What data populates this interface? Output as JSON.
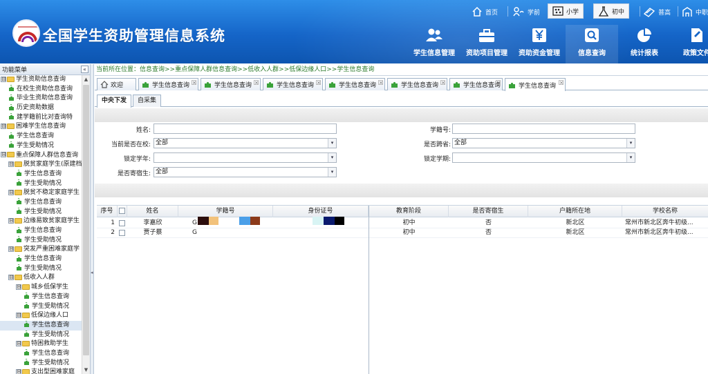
{
  "header": {
    "title": "全国学生资助管理信息系统",
    "top_links": [
      {
        "label": "首页",
        "icon": "home-icon"
      },
      {
        "label": "学前",
        "icon": "child-icon"
      },
      {
        "label": "小学",
        "icon": "abacus-icon"
      },
      {
        "label": "初中",
        "icon": "flask-icon"
      },
      {
        "label": "普高",
        "icon": "book-icon"
      },
      {
        "label": "中职",
        "icon": "building-icon"
      }
    ],
    "nav": [
      {
        "label": "学生信息管理",
        "icon": "users-icon"
      },
      {
        "label": "资助项目管理",
        "icon": "briefcase-icon"
      },
      {
        "label": "资助资金管理",
        "icon": "yuan-icon"
      },
      {
        "label": "信息查询",
        "icon": "search-icon"
      },
      {
        "label": "统计报表",
        "icon": "pie-chart-icon"
      },
      {
        "label": "政策文件",
        "icon": "document-icon"
      }
    ],
    "active_nav": "信息查询"
  },
  "sidebar": {
    "title": "功能菜单",
    "collapse_glyph": "«",
    "tree": [
      {
        "label": "学生资助信息查询",
        "level": 0,
        "type": "folder",
        "expander": "⊟"
      },
      {
        "label": "在校生资助信息查询",
        "level": 1,
        "type": "leaf"
      },
      {
        "label": "毕业生资助信息查询",
        "level": 1,
        "type": "leaf"
      },
      {
        "label": "历史资助数据",
        "level": 1,
        "type": "leaf"
      },
      {
        "label": "建学籍前比对查询特",
        "level": 1,
        "type": "leaf"
      },
      {
        "label": "困难学生信息查询",
        "level": 0,
        "type": "folder",
        "expander": "⊟"
      },
      {
        "label": "学生信息查询",
        "level": 1,
        "type": "leaf"
      },
      {
        "label": "学生受助情况",
        "level": 1,
        "type": "leaf"
      },
      {
        "label": "重点保障人群信息查询",
        "level": 0,
        "type": "folder",
        "expander": "⊟"
      },
      {
        "label": "脱贫家庭学生(原建档",
        "level": 1,
        "type": "folder",
        "expander": "⊟"
      },
      {
        "label": "学生信息查询",
        "level": 2,
        "type": "leaf"
      },
      {
        "label": "学生受助情况",
        "level": 2,
        "type": "leaf"
      },
      {
        "label": "脱贫不稳定家庭学生",
        "level": 1,
        "type": "folder",
        "expander": "⊟"
      },
      {
        "label": "学生信息查询",
        "level": 2,
        "type": "leaf"
      },
      {
        "label": "学生受助情况",
        "level": 2,
        "type": "leaf"
      },
      {
        "label": "边缘易致贫家庭学生",
        "level": 1,
        "type": "folder",
        "expander": "⊟"
      },
      {
        "label": "学生信息查询",
        "level": 2,
        "type": "leaf"
      },
      {
        "label": "学生受助情况",
        "level": 2,
        "type": "leaf"
      },
      {
        "label": "突发严重困难家庭学",
        "level": 1,
        "type": "folder",
        "expander": "⊟"
      },
      {
        "label": "学生信息查询",
        "level": 2,
        "type": "leaf"
      },
      {
        "label": "学生受助情况",
        "level": 2,
        "type": "leaf"
      },
      {
        "label": "低收入人群",
        "level": 1,
        "type": "folder",
        "expander": "⊟"
      },
      {
        "label": "城乡低保学生",
        "level": 2,
        "type": "folder",
        "expander": "⊟"
      },
      {
        "label": "学生信息查询",
        "level": 3,
        "type": "leaf"
      },
      {
        "label": "学生受助情况",
        "level": 3,
        "type": "leaf"
      },
      {
        "label": "低保边缘人口",
        "level": 2,
        "type": "folder",
        "expander": "⊟"
      },
      {
        "label": "学生信息查询",
        "level": 3,
        "type": "leaf",
        "selected": true
      },
      {
        "label": "学生受助情况",
        "level": 3,
        "type": "leaf"
      },
      {
        "label": "特困救助学生",
        "level": 2,
        "type": "folder",
        "expander": "⊟"
      },
      {
        "label": "学生信息查询",
        "level": 3,
        "type": "leaf"
      },
      {
        "label": "学生受助情况",
        "level": 3,
        "type": "leaf"
      },
      {
        "label": "支出型困难家庭",
        "level": 2,
        "type": "folder",
        "expander": "⊟"
      }
    ]
  },
  "breadcrumb": "当前所在位置：信息查询>>重点保障人群信息查询>>低收入人群>>低保边缘人口>>学生信息查询",
  "tabs": [
    {
      "label": "欢迎",
      "icon": "home-icon",
      "closable": false
    },
    {
      "label": "学生信息查询",
      "closable": true
    },
    {
      "label": "学生信息查询",
      "closable": true
    },
    {
      "label": "学生信息查询",
      "closable": true
    },
    {
      "label": "学生信息查询",
      "closable": true
    },
    {
      "label": "学生信息查询",
      "closable": true
    },
    {
      "label": "学生信息查询",
      "closable": true
    },
    {
      "label": "学生信息查询",
      "closable": true,
      "active": true
    }
  ],
  "tab_close_glyph": "×",
  "subtabs": [
    {
      "label": "中央下发",
      "active": true
    },
    {
      "label": "自采集"
    }
  ],
  "form": {
    "name_label": "姓名:",
    "name_value": "",
    "student_no_label": "学籍号:",
    "student_no_value": "",
    "in_school_label": "当前是否在校:",
    "in_school_value": "全部",
    "cross_province_label": "是否跨省:",
    "cross_province_value": "全部",
    "lock_year_label": "锁定学年:",
    "lock_year_value": "",
    "lock_term_label": "锁定学期:",
    "lock_term_value": "",
    "boarding_label": "是否寄宿生:",
    "boarding_value": "全部",
    "dropdown_glyph": "▾"
  },
  "grid": {
    "columns": [
      "序号",
      "姓名",
      "学籍号",
      "身份证号",
      "教育阶段",
      "是否寄宿生",
      "户籍所在地",
      "学校名称"
    ],
    "rows": [
      {
        "seq": "1",
        "name": "李嘉欣",
        "student_no": "G",
        "id_no": "",
        "stage": "初中",
        "boarding": "否",
        "huji": "新北区",
        "school": "常州市新北区奔牛初级..."
      },
      {
        "seq": "2",
        "name": "贾子蔡",
        "student_no": "G",
        "id_no": "",
        "stage": "初中",
        "boarding": "否",
        "huji": "新北区",
        "school": "常州市新北区奔牛初级..."
      }
    ],
    "redaction_colors": [
      "#2b0d0d",
      "#f2c27b",
      "#4a9fe8",
      "#8b3a1a",
      "#d8f4f4",
      "#0a1a6e",
      "#000000"
    ]
  },
  "scroll_arrows": {
    "up": "▲",
    "down": "▼",
    "splitter": "◂"
  },
  "colors": {
    "header_blue": "#1565c8",
    "crumb_green": "#2a7a2a",
    "folder_yellow": "#f2c94c",
    "leaf_green": "#3aa23a"
  }
}
